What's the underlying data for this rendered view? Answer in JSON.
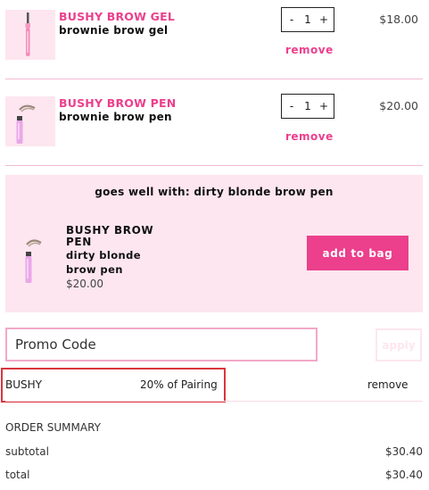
{
  "cart": {
    "items": [
      {
        "name": "BUSHY BROW GEL",
        "shade": "brownie brow gel",
        "qty": "1",
        "qty_minus": "-",
        "qty_plus": "+",
        "price": "$18.00",
        "remove": "remove",
        "icon": "brow-gel-tube-icon"
      },
      {
        "name": "BUSHY BROW PEN",
        "shade": "brownie brow pen",
        "qty": "1",
        "qty_minus": "-",
        "qty_plus": "+",
        "price": "$20.00",
        "remove": "remove",
        "icon": "brow-pen-icon"
      }
    ]
  },
  "upsell": {
    "title": "goes well with: dirty blonde brow pen",
    "name": "BUSHY BROW PEN",
    "shade": "dirty blonde brow pen",
    "price": "$20.00",
    "button": "add to bag",
    "icon": "brow-pen-icon"
  },
  "promo": {
    "placeholder": "Promo Code",
    "apply": "apply",
    "applied_code": "BUSHY",
    "applied_desc": "20% of Pairing",
    "remove": "remove"
  },
  "summary": {
    "heading": "ORDER SUMMARY",
    "subtotal_label": "subtotal",
    "subtotal_value": "$30.40",
    "total_label": "total",
    "total_value": "$30.40"
  },
  "colors": {
    "brand_pink": "#ec3f8c",
    "soft_pink": "#fde6ef",
    "highlight_red": "#d9363e"
  }
}
